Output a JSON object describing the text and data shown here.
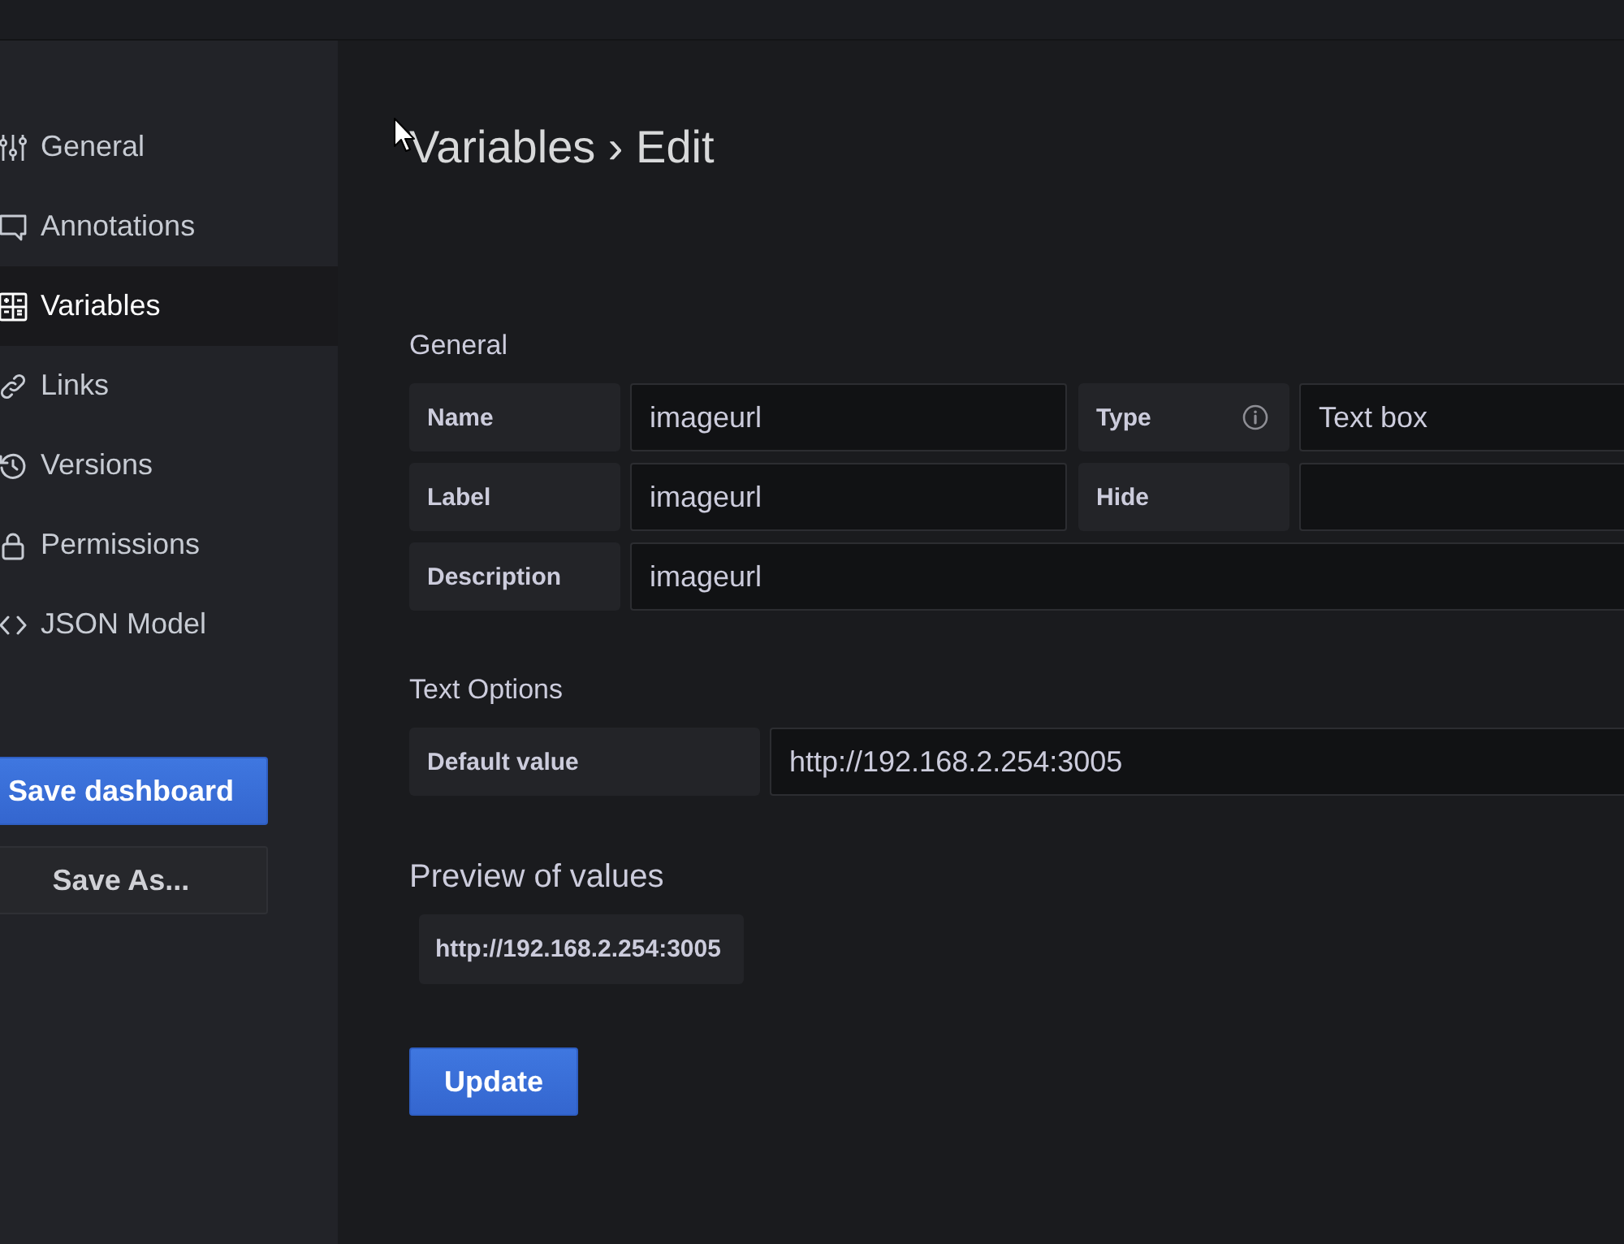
{
  "sidebar": {
    "items": [
      {
        "label": "General",
        "selected": false
      },
      {
        "label": "Annotations",
        "selected": false
      },
      {
        "label": "Variables",
        "selected": true
      },
      {
        "label": "Links",
        "selected": false
      },
      {
        "label": "Versions",
        "selected": false
      },
      {
        "label": "Permissions",
        "selected": false
      },
      {
        "label": "JSON Model",
        "selected": false
      }
    ],
    "buttons": [
      {
        "label": "Save dashboard",
        "kind": "primary"
      },
      {
        "label": "Save As...",
        "kind": "secondary"
      }
    ]
  },
  "page": {
    "title": "Variables › Edit"
  },
  "general": {
    "title": "General",
    "rows": [
      [
        {
          "label": "Name",
          "value": "imageurl",
          "info_icon": false
        },
        {
          "label": "Type",
          "value": "Text box",
          "info_icon": true
        }
      ],
      [
        {
          "label": "Label",
          "value": "imageurl",
          "info_icon": false
        },
        {
          "label": "Hide",
          "info_icon": false
        }
      ],
      [
        {
          "label": "Description",
          "value": "imageurl",
          "info_icon": false
        }
      ]
    ]
  },
  "text_options": {
    "title": "Text Options",
    "fields": [
      {
        "label": "Default value",
        "value": "http://192.168.2.254:3005"
      }
    ]
  },
  "preview": {
    "title": "Preview of values",
    "values": [
      "http://192.168.2.254:3005"
    ]
  },
  "update_button": {
    "label": "Update"
  }
}
